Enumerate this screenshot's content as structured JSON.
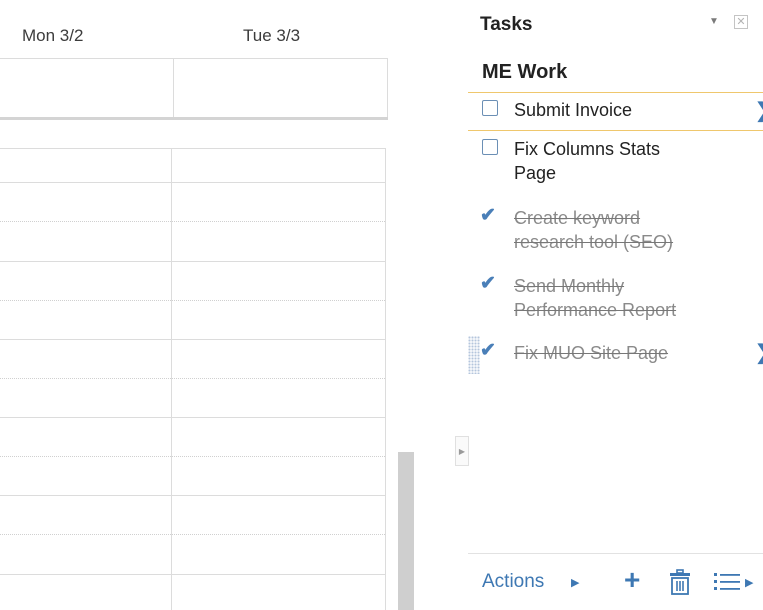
{
  "calendar": {
    "days": [
      {
        "label": "Mon 3/2"
      },
      {
        "label": "Tue 3/3"
      }
    ]
  },
  "tasks_panel": {
    "title": "Tasks",
    "list_name": "ME Work",
    "tasks": [
      {
        "text": "Submit Invoice",
        "completed": false,
        "selected": true
      },
      {
        "text_lines": [
          "Fix Columns Stats",
          "Page"
        ],
        "completed": false
      },
      {
        "text_lines": [
          "Create keyword",
          "research tool (SEO)"
        ],
        "completed": true
      },
      {
        "text_lines": [
          "Send Monthly",
          "Performance Report"
        ],
        "completed": true
      },
      {
        "text": "Fix MUO Site Page",
        "completed": true
      }
    ],
    "footer": {
      "actions_label": "Actions"
    },
    "icons": {
      "dropdown": "triangle-down-icon",
      "close": "close-box-icon",
      "add": "plus-icon",
      "delete": "trash-icon",
      "lists": "list-icon",
      "edit_details": "chevron-right-icon",
      "collapse": "triangle-right-icon"
    },
    "colors": {
      "accent": "#3e78b3",
      "selection_border": "#efc76d",
      "completed_text": "#8a8a8a"
    }
  }
}
